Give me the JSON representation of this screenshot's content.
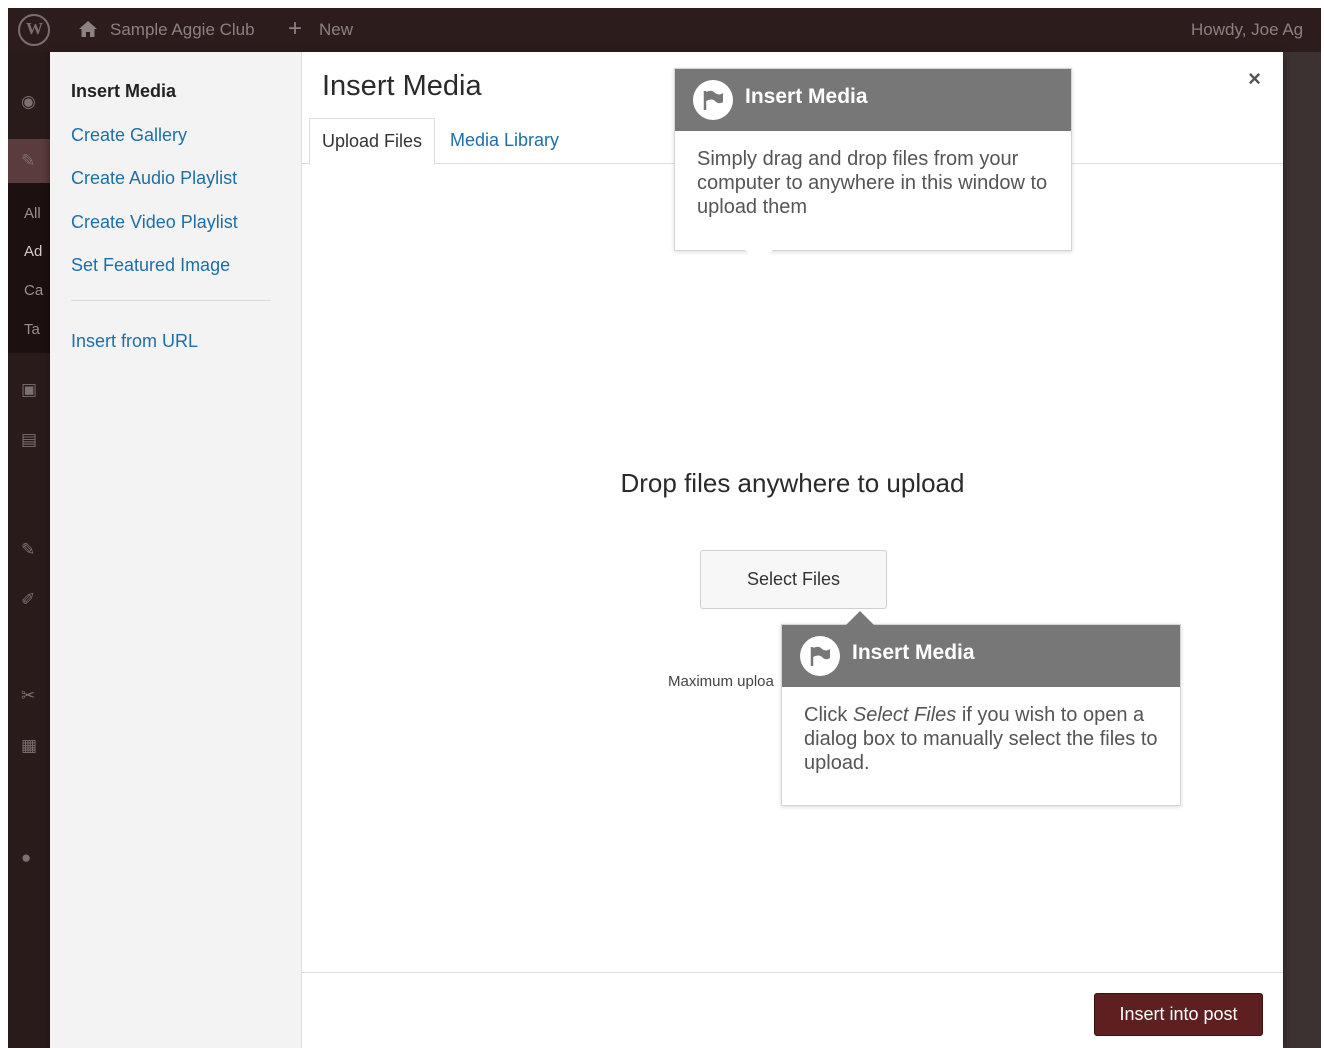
{
  "admin_bar": {
    "site_name": "Sample Aggie Club",
    "new_label": "New",
    "howdy": "Howdy, Joe Ag"
  },
  "admin_menu": {
    "sub_items": [
      "All",
      "Ad",
      "Ca",
      "Ta"
    ]
  },
  "modal": {
    "title": "Insert Media",
    "close_label": "×",
    "menu": {
      "items": [
        {
          "label": "Insert Media"
        },
        {
          "label": "Create Gallery"
        },
        {
          "label": "Create Audio Playlist"
        },
        {
          "label": "Create Video Playlist"
        },
        {
          "label": "Set Featured Image"
        },
        {
          "label": "Insert from URL"
        }
      ]
    },
    "tabs": [
      {
        "label": "Upload Files"
      },
      {
        "label": "Media Library"
      }
    ],
    "upload": {
      "drop_text": "Drop files anywhere to upload",
      "select_button": "Select Files",
      "max_upload": "Maximum uploa"
    },
    "footer": {
      "insert_button": "Insert into post"
    }
  },
  "pointers": [
    {
      "title": "Insert Media",
      "body": "Simply drag and drop files from your computer to anywhere in this window to upload them"
    },
    {
      "title": "Insert Media",
      "body_pre": "Click ",
      "body_em": "Select Files",
      "body_post": " if you wish to open a dialog box to manually select the files to upload."
    }
  ]
}
